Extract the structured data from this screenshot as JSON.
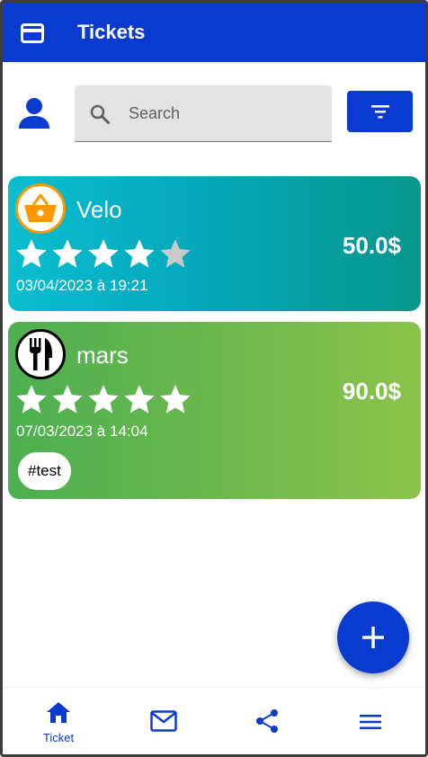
{
  "app": {
    "title": "Tickets",
    "accent_color": "#0a3bd1"
  },
  "search": {
    "placeholder": "Search"
  },
  "tickets": [
    {
      "name": "Velo",
      "category_icon": "shopping-basket-icon",
      "rating": 4,
      "max_rating": 5,
      "date": "03/04/2023 à 19:21",
      "price": "50.0$",
      "tags": []
    },
    {
      "name": "mars",
      "category_icon": "restaurant-icon",
      "rating": 5,
      "max_rating": 5,
      "date": "07/03/2023 à 14:04",
      "price": "90.0$",
      "tags": [
        "#test"
      ]
    }
  ],
  "bottom_nav": {
    "items": [
      {
        "icon": "home-icon",
        "label": "Ticket",
        "active": true
      },
      {
        "icon": "mail-icon",
        "label": "",
        "active": false
      },
      {
        "icon": "share-icon",
        "label": "",
        "active": false
      },
      {
        "icon": "menu-icon",
        "label": "",
        "active": false
      }
    ]
  }
}
